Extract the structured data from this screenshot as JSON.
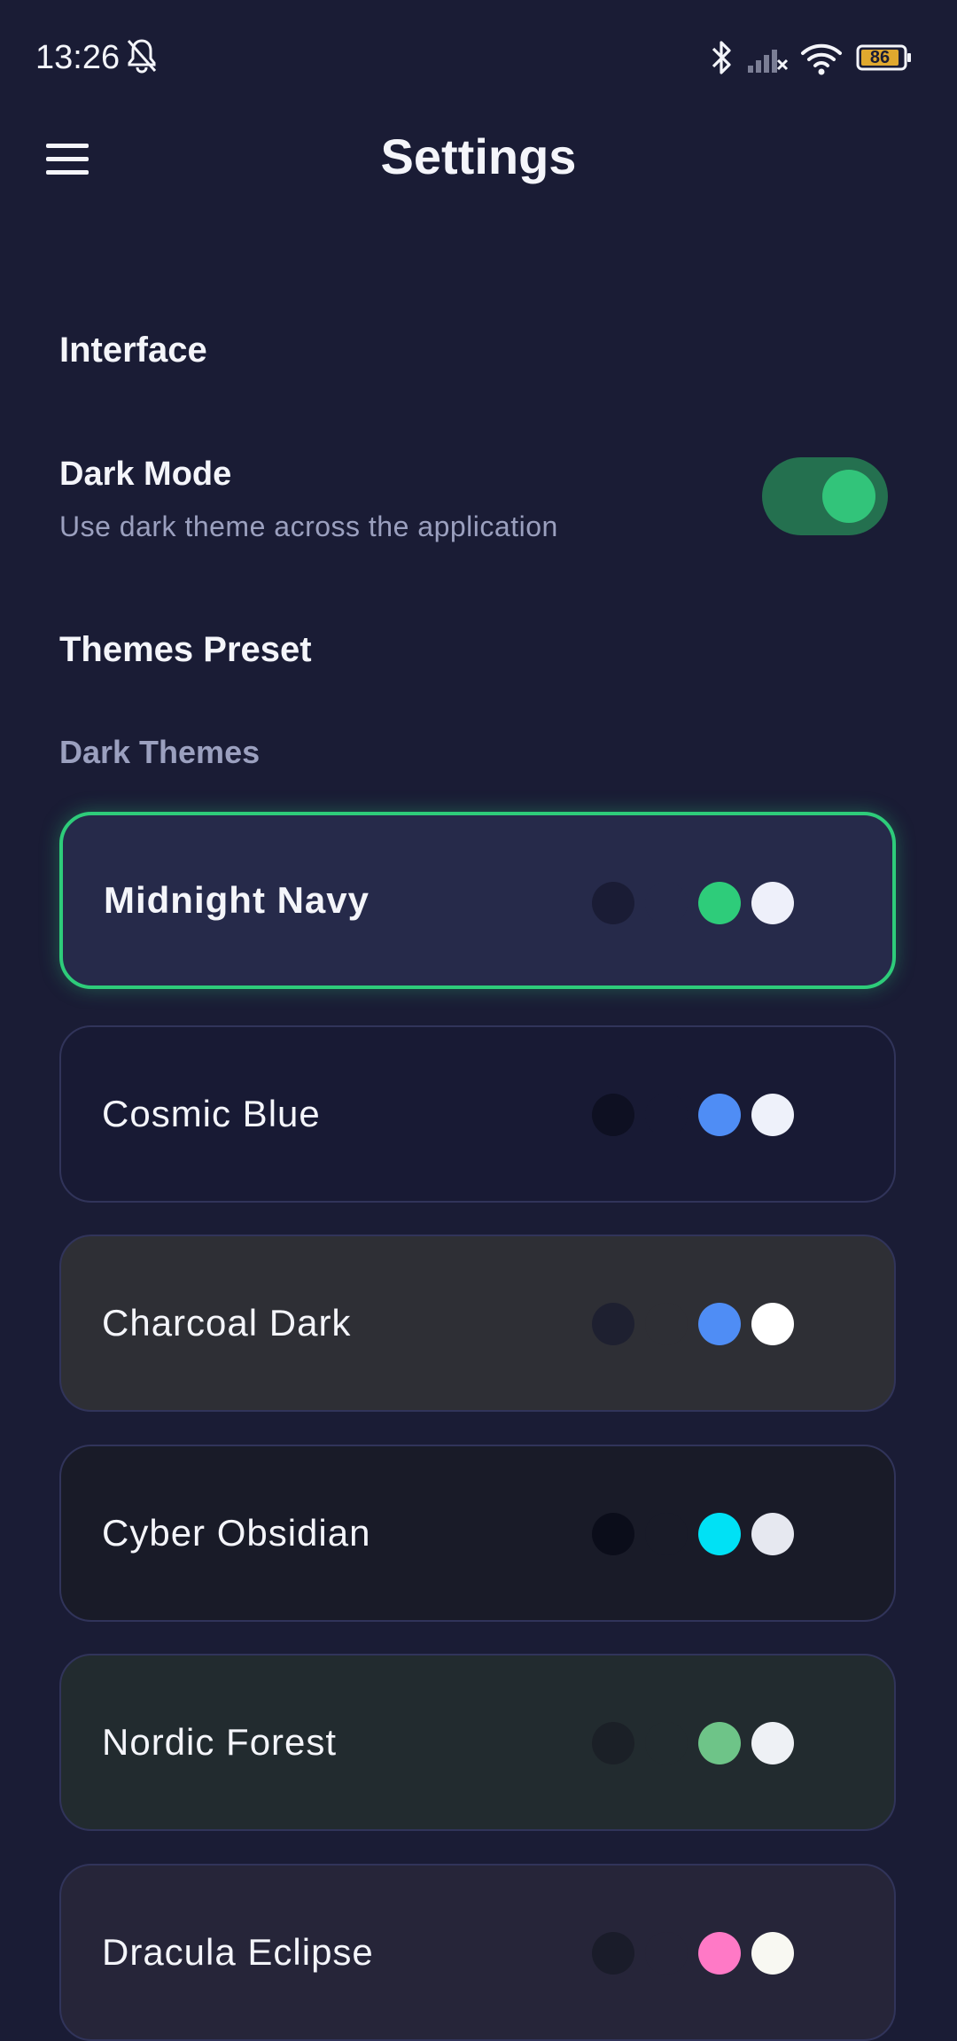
{
  "status_bar": {
    "time": "13:26",
    "battery": "86",
    "icons": [
      "bell-off-icon",
      "bluetooth-icon",
      "signal-off-icon",
      "wifi-icon",
      "battery-icon"
    ]
  },
  "app_bar": {
    "title": "Settings",
    "menu_icon": "hamburger-menu-icon"
  },
  "interface": {
    "section_title": "Interface",
    "dark_mode": {
      "label": "Dark Mode",
      "description": "Use dark theme across the application",
      "enabled": true
    }
  },
  "themes": {
    "section_title": "Themes Preset",
    "subsection_title": "Dark Themes",
    "selected": "Midnight Navy",
    "items": [
      {
        "name": "Midnight Navy",
        "bg": "#262A4A",
        "colors": [
          "#1A1C35",
          "#262A4A",
          "#2ECC7A",
          "#EEF0FA"
        ]
      },
      {
        "name": "Cosmic Blue",
        "bg": "#181A34",
        "colors": [
          "#0E1022",
          "#181A34",
          "#4F8DF5",
          "#EEF1FA"
        ]
      },
      {
        "name": "Charcoal Dark",
        "bg": "#2E2F35",
        "colors": [
          "#1E2030",
          "#2E2F35",
          "#4F8DF5",
          "#FFFFFF"
        ]
      },
      {
        "name": "Cyber Obsidian",
        "bg": "#191B28",
        "colors": [
          "#0B0D1A",
          "#191B28",
          "#00E1F5",
          "#E6E8F0"
        ]
      },
      {
        "name": "Nordic Forest",
        "bg": "#222B2F",
        "colors": [
          "#1B2027",
          "#222B2F",
          "#6EC488",
          "#EEF1F5"
        ]
      },
      {
        "name": "Dracula Eclipse",
        "bg": "#262539",
        "colors": [
          "#1A1C2A",
          "#262539",
          "#FF79C6",
          "#F8F8F2"
        ]
      }
    ]
  },
  "colors": {
    "background": "#1A1C35",
    "accent": "#2ECC7A",
    "text_primary": "#F4F5FA",
    "text_secondary": "#9BA0BF"
  }
}
